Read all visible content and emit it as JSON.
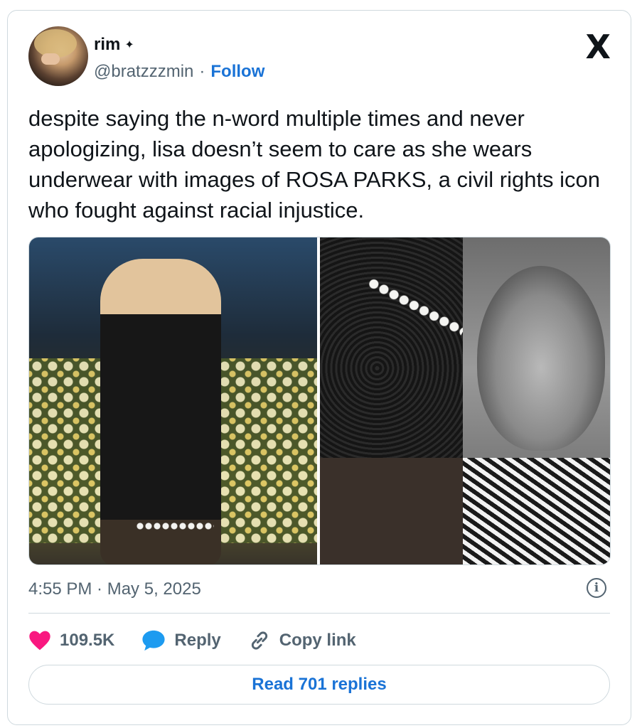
{
  "author": {
    "name": "rim",
    "name_badge": "✦",
    "handle": "@bratzzzmin",
    "separator": "·",
    "follow_label": "Follow"
  },
  "brand": {
    "logo_text": "X",
    "logo_icon": "x-logo-icon"
  },
  "tweet": {
    "text": "despite saying the n-word multiple times and never apologizing, lisa doesn’t seem to care as she wears underwear with images of ROSA PARKS, a civil rights icon who fought against racial injustice.",
    "timestamp": "4:55 PM · May 5, 2025",
    "info_icon_text": "i"
  },
  "media": {
    "images": [
      {
        "name": "photo-red-carpet"
      },
      {
        "name": "photo-underwear-closeup"
      },
      {
        "name": "photo-black-white-portrait"
      }
    ]
  },
  "actions": {
    "like_count": "109.5K",
    "reply_label": "Reply",
    "copy_link_label": "Copy link"
  },
  "read_replies_label": "Read 701 replies",
  "colors": {
    "like": "#f91880",
    "reply": "#1d9bf0",
    "link": "#1a73d6",
    "muted": "#536471",
    "border": "#cfd9de"
  }
}
